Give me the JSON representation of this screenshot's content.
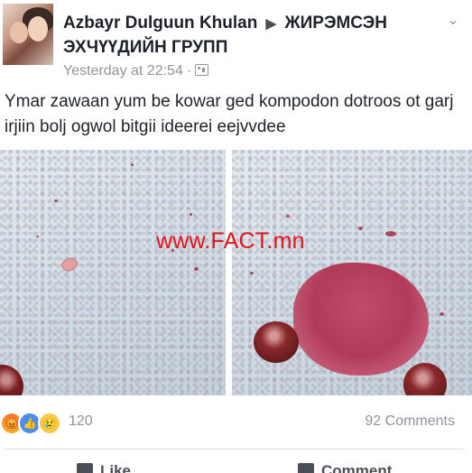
{
  "post": {
    "author": "Azbayr Dulguun Khulan",
    "separator_icon": "right-triangle-arrow",
    "group": "ЖИРЭМСЭН ЭХЧҮҮДИЙН ГРУПП",
    "timestamp": "Yesterday at 22:54",
    "meta_separator": "·",
    "audience_icon": "group-audience-icon",
    "menu_icon": "chevron-down",
    "text": "Ymar zawaan yum be kowar ged kompodon dotroos ot garj irjiin bolj ogwol bitgii ideerei eejvvdee"
  },
  "photos": {
    "watermark": "www.FACT.mn"
  },
  "reactions": {
    "icons": [
      "angry",
      "like",
      "sad"
    ],
    "count": "120",
    "comments": "92 Comments"
  },
  "actions": {
    "like": "Like",
    "comment": "Comment"
  },
  "colors": {
    "text": "#1d2129",
    "meta": "#90949c",
    "watermark": "#e3141b",
    "like_blue": "#4a8ef5"
  }
}
